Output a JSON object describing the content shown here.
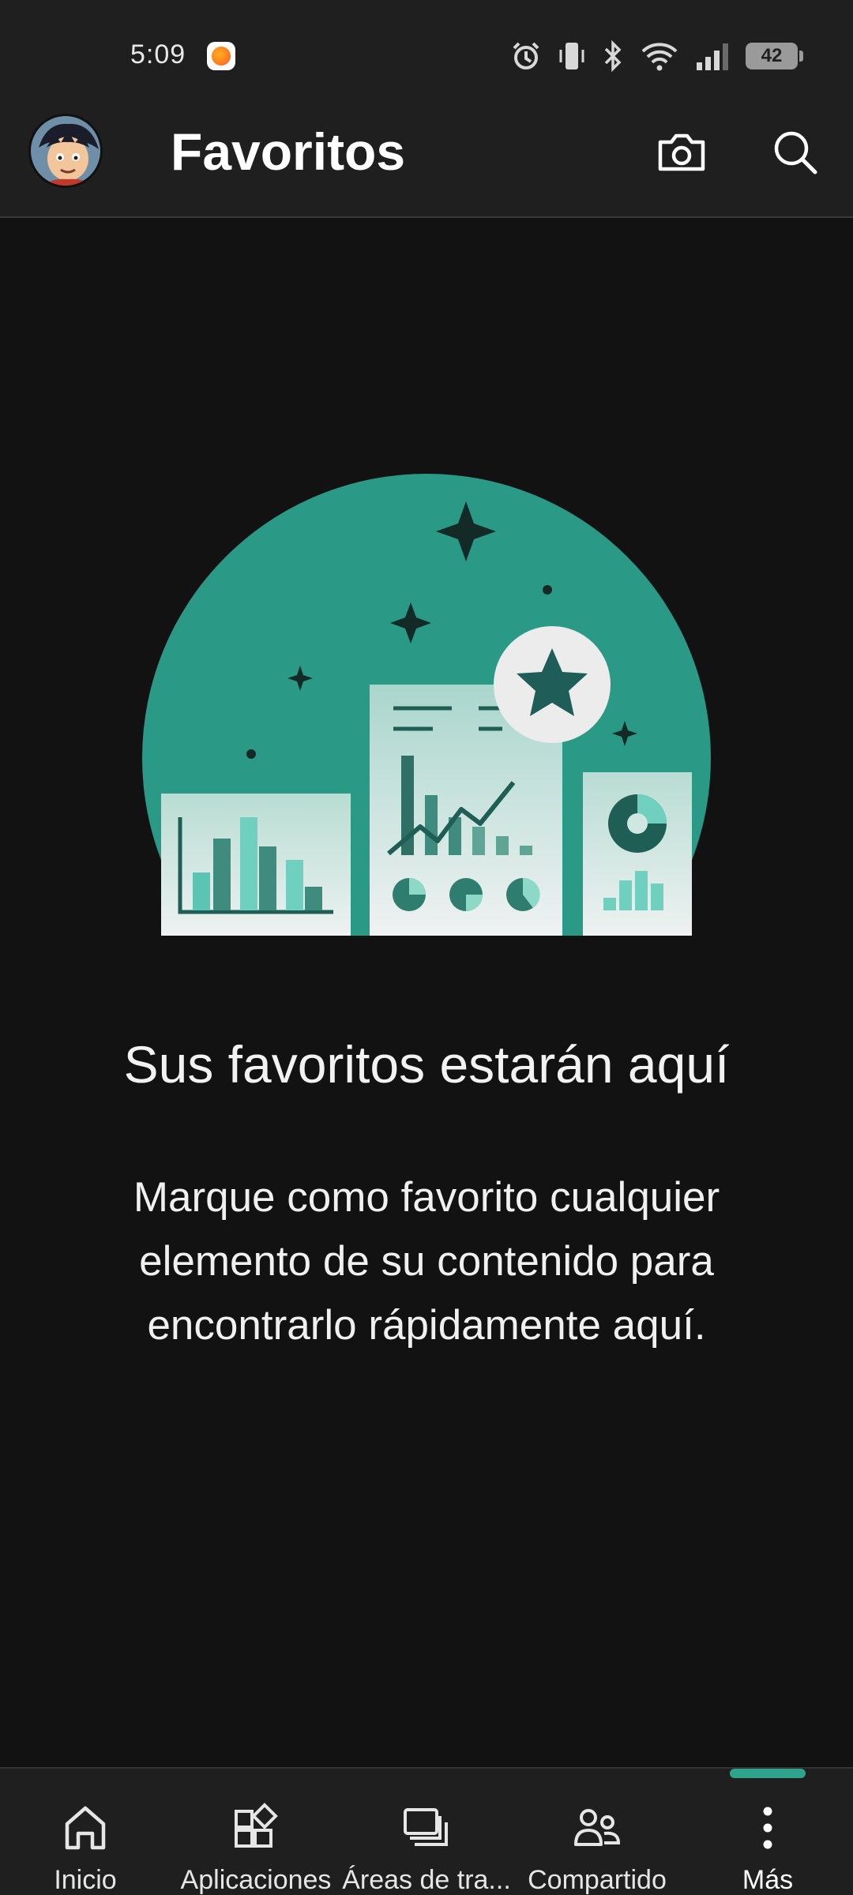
{
  "status_bar": {
    "time": "5:09",
    "battery": "42",
    "icons": [
      "alarm-icon",
      "vibrate-icon",
      "bluetooth-icon",
      "wifi-icon",
      "signal-icon",
      "battery-icon"
    ]
  },
  "header": {
    "title": "Favoritos",
    "actions": [
      "camera-icon",
      "search-icon"
    ]
  },
  "empty_state": {
    "title": "Sus favoritos estarán aquí",
    "description": "Marque como favorito cualquier elemento de su contenido para encontrarlo rápidamente aquí."
  },
  "nav": {
    "items": [
      {
        "label": "Inicio",
        "icon": "home-icon"
      },
      {
        "label": "Aplicaciones",
        "icon": "apps-icon"
      },
      {
        "label": "Áreas de tra...",
        "icon": "workspaces-icon"
      },
      {
        "label": "Compartido",
        "icon": "shared-icon"
      },
      {
        "label": "Más",
        "icon": "more-icon"
      }
    ],
    "active_index": 4
  },
  "colors": {
    "accent": "#2fa38e",
    "background": "#121212",
    "bar": "#1f1f1f"
  }
}
